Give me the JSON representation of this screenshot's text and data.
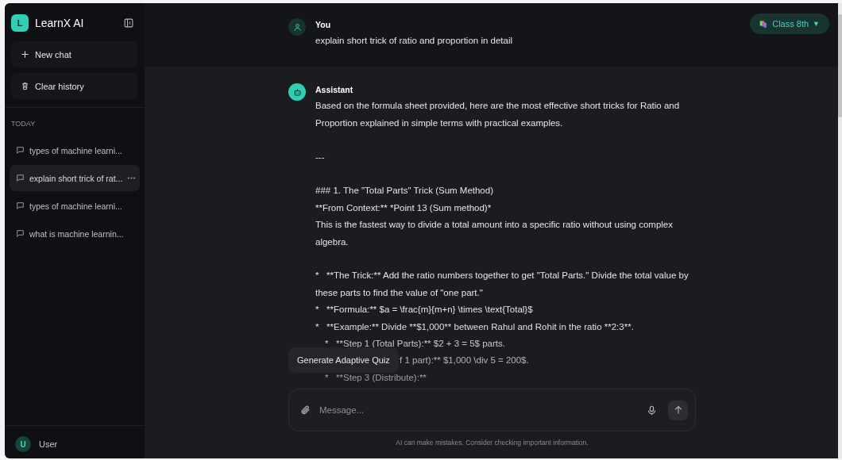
{
  "sidebar": {
    "brand": {
      "initial": "L",
      "name": "LearnX AI"
    },
    "actions": [
      {
        "kind": "new",
        "label": "New chat"
      },
      {
        "kind": "clear",
        "label": "Clear history"
      }
    ],
    "section": "TODAY",
    "chats": [
      {
        "title": "types of machine learni...",
        "selected": false
      },
      {
        "title": "explain short trick of rat...",
        "selected": true
      },
      {
        "title": "types of machine learni...",
        "selected": false
      },
      {
        "title": "what is machine learnin...",
        "selected": false
      }
    ],
    "user": {
      "initial": "U",
      "name": "User"
    }
  },
  "class_selector": {
    "label": "Class 8th",
    "caret": "▼"
  },
  "messages": [
    {
      "kind": "user",
      "author": "You",
      "blocks": [
        {
          "lines": [
            {
              "kind": "para",
              "text": "explain short trick of ratio and proportion in detail"
            }
          ]
        }
      ]
    },
    {
      "kind": "assistant",
      "author": "Assistant",
      "blocks": [
        {
          "lines": [
            {
              "kind": "para",
              "text": "Based on the formula sheet provided, here are the most effective short tricks for Ratio and Proportion explained in simple terms with practical examples."
            }
          ]
        },
        {
          "lines": [
            {
              "kind": "para",
              "text": "---"
            }
          ]
        },
        {
          "lines": [
            {
              "kind": "para",
              "text": "### 1. The \"Total Parts\" Trick (Sum Method)"
            },
            {
              "kind": "para",
              "text": "**From Context:** *Point 13 (Sum method)*"
            },
            {
              "kind": "para",
              "text": "This is the fastest way to divide a total amount into a specific ratio without using complex algebra."
            }
          ]
        },
        {
          "lines": [
            {
              "kind": "para",
              "text": "*   **The Trick:** Add the ratio numbers together to get \"Total Parts.\" Divide the total value by these parts to find the value of \"one part.\""
            },
            {
              "kind": "para",
              "text": "*   **Formula:** $a = \\frac{m}{m+n} \\times \\text{Total}$"
            },
            {
              "kind": "para",
              "text": "*   **Example:** Divide **$1,000** between Rahul and Rohit in the ratio **2:3**."
            },
            {
              "kind": "sub",
              "text": "*   **Step 1 (Total Parts):** $2 + 3 = 5$ parts."
            },
            {
              "kind": "covered",
              "text": "f 1 part):** $1,000 \\div 5 = 200$."
            },
            {
              "kind": "sub",
              "text": "*   **Step 3 (Distribute):**"
            }
          ]
        }
      ]
    }
  ],
  "tooltip": "Generate Adaptive Quiz",
  "composer": {
    "placeholder": "Message..."
  },
  "disclaimer": "AI can make mistakes. Consider checking important information."
}
